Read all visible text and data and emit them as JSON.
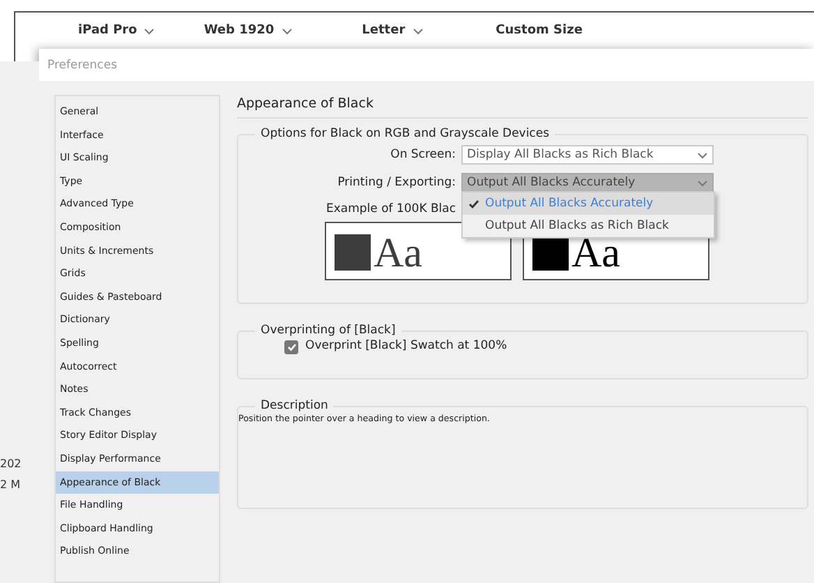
{
  "app_toolbar": {
    "presets": [
      {
        "label": "iPad Pro",
        "has_menu": true
      },
      {
        "label": "Web 1920",
        "has_menu": true
      },
      {
        "label": "Letter",
        "has_menu": true
      },
      {
        "label": "Custom Size",
        "has_menu": false
      }
    ]
  },
  "background_texts": [
    "202",
    "2 M"
  ],
  "dialog": {
    "title": "Preferences"
  },
  "sidebar": {
    "items": [
      {
        "label": "General",
        "selected": false
      },
      {
        "label": "Interface",
        "selected": false
      },
      {
        "label": "UI Scaling",
        "selected": false
      },
      {
        "label": "Type",
        "selected": false
      },
      {
        "label": "Advanced Type",
        "selected": false
      },
      {
        "label": "Composition",
        "selected": false
      },
      {
        "label": "Units & Increments",
        "selected": false
      },
      {
        "label": "Grids",
        "selected": false
      },
      {
        "label": "Guides & Pasteboard",
        "selected": false
      },
      {
        "label": "Dictionary",
        "selected": false
      },
      {
        "label": "Spelling",
        "selected": false
      },
      {
        "label": "Autocorrect",
        "selected": false
      },
      {
        "label": "Notes",
        "selected": false
      },
      {
        "label": "Track Changes",
        "selected": false
      },
      {
        "label": "Story Editor Display",
        "selected": false
      },
      {
        "label": "Display Performance",
        "selected": false
      },
      {
        "label": "Appearance of Black",
        "selected": true
      },
      {
        "label": "File Handling",
        "selected": false
      },
      {
        "label": "Clipboard Handling",
        "selected": false
      },
      {
        "label": "Publish Online",
        "selected": false
      }
    ]
  },
  "page_title": "Appearance of Black",
  "black_options": {
    "legend": "Options for Black on RGB and Grayscale Devices",
    "on_screen": {
      "label": "On Screen:",
      "value": "Display All Blacks as Rich Black",
      "expanded": false
    },
    "printing": {
      "label": "Printing / Exporting:",
      "value": "Output All Blacks Accurately",
      "expanded": true,
      "options": [
        {
          "label": "Output All Blacks Accurately",
          "selected": true
        },
        {
          "label": "Output All Blacks as Rich Black",
          "selected": false
        }
      ]
    },
    "example_label": "Example of 100K Blac",
    "samples": [
      {
        "text": "Aa",
        "rich_black": false
      },
      {
        "text": "Aa",
        "rich_black": true
      }
    ]
  },
  "overprinting": {
    "legend": "Overprinting of [Black]",
    "checkbox": {
      "label": "Overprint [Black] Swatch at 100%",
      "checked": true
    }
  },
  "description": {
    "legend": "Description",
    "text": "Position the pointer over a heading to view a description."
  }
}
